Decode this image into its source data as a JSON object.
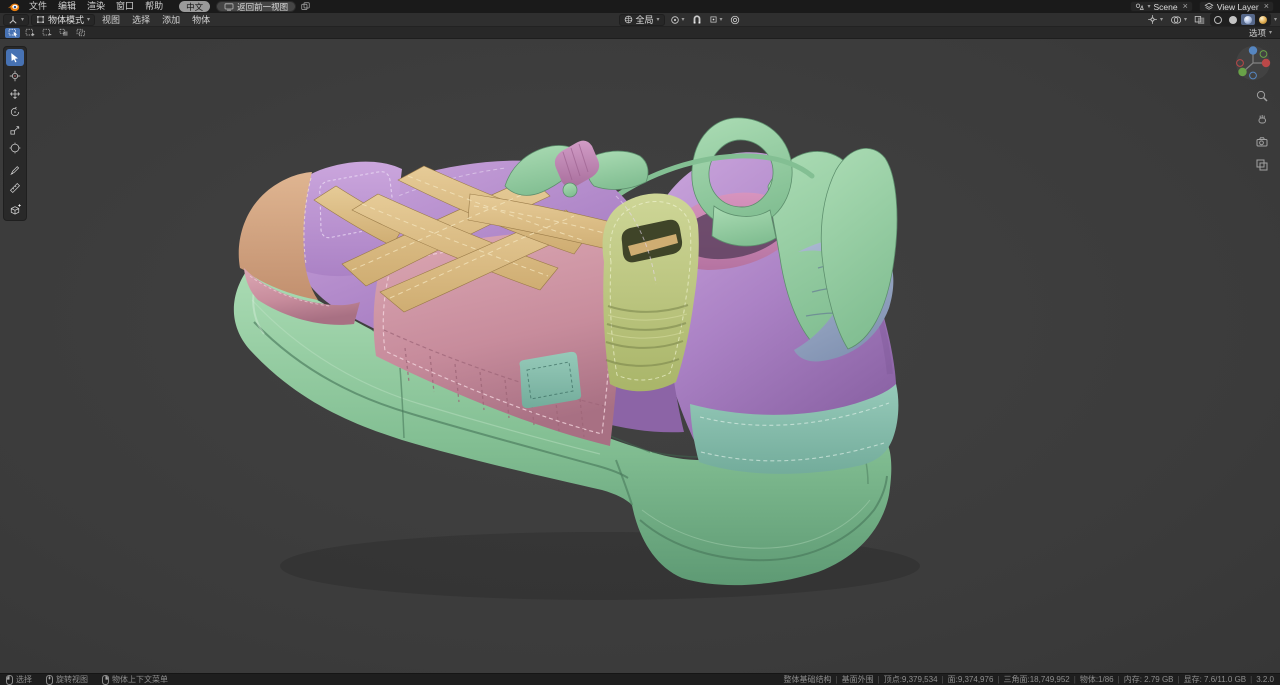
{
  "glyphs": {
    "caret": "▾",
    "close": "×"
  },
  "palette": {
    "topbar-bg": "#1a1a1a",
    "header-bg": "#2f2f2f",
    "toolsettings-bg": "#282828",
    "statusbar-bg": "#1e1e1e",
    "field-bg": "#272727",
    "accent-blue": "#4772b3",
    "viewport-bg": "#3b3b3b",
    "sole-light": "#abdcb4",
    "sole-mid": "#83bf93",
    "sole-dark": "#5e9a74",
    "upper-light": "#cba6dd",
    "upper-mid": "#ab82c5",
    "upper-dark": "#8c64a6",
    "pink-light": "#dca8b4",
    "pink-mid": "#c78c9c",
    "pink-dark": "#a87083",
    "lace-light": "#e6cb97",
    "lace-mid": "#cfad72",
    "teal-light": "#96cab9",
    "teal-mid": "#73ac9b",
    "strap-light": "#ced697",
    "strap-mid": "#a9b569",
    "fin-light": "#adbad4",
    "fin-mid": "#8394b3",
    "magenta-light": "#d794be",
    "magenta-mid": "#b573a1",
    "toggle-pink": "#d19cc6",
    "toe-light": "#dfb591",
    "toe-mid": "#c2906f"
  },
  "topbar": {
    "menus": [
      "文件",
      "编辑",
      "渲染",
      "窗口",
      "帮助"
    ],
    "language_button": "中文",
    "back_view_button": "返回前一视图",
    "scene_selector": {
      "value": "Scene"
    },
    "view_layer_selector": {
      "value": "View Layer"
    }
  },
  "viewport_header": {
    "mode_select": {
      "value": "物体模式"
    },
    "menus": [
      "视图",
      "选择",
      "添加",
      "物体"
    ],
    "orientation_select": {
      "value": "全局"
    },
    "shading_modes": [
      "wireframe",
      "solid",
      "material-preview",
      "rendered"
    ],
    "active_shading": "material-preview"
  },
  "tool_settings": {
    "options_dropdown": "选项"
  },
  "tools": [
    "box-select",
    "cursor",
    "move",
    "rotate",
    "scale",
    "transform",
    "annotate",
    "measure",
    "add-cube"
  ],
  "statusbar": {
    "hints": [
      {
        "button": "left-mouse",
        "label": "选择"
      },
      {
        "button": "middle-mouse",
        "label": "旋转视图"
      },
      {
        "button": "right-mouse",
        "label": "物体上下文菜单"
      }
    ],
    "stats": [
      "整体基础结构",
      "基面外围",
      "顶点:9,379,534",
      "面:9,374,976",
      "三角面:18,749,952",
      "物体:1/86",
      "内存: 2.79 GB",
      "显存: 7.6/11.0 GB",
      "3.2.0"
    ]
  }
}
